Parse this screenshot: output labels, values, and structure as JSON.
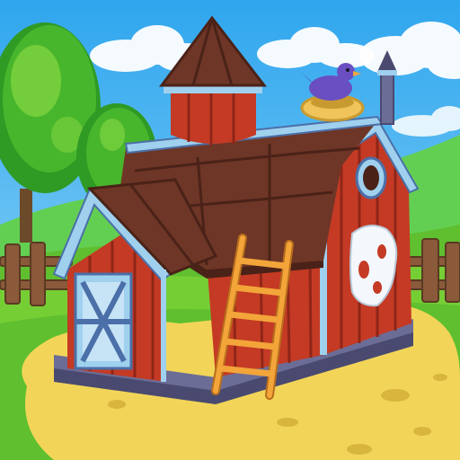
{
  "colors": {
    "sky_top": "#2fa6ee",
    "sky_bottom": "#9fdcf8",
    "cloud": "#ffffff",
    "hill_far": "#63cf52",
    "grass": "#5fbf2f",
    "grass_light": "#86d83a",
    "path": "#f2d558",
    "path_dark": "#d8b53d",
    "tree_dark": "#2f9a24",
    "tree_mid": "#48b62c",
    "tree_light": "#7fd440",
    "barn_red": "#c43a24",
    "barn_red_dark": "#8f2618",
    "barn_trim": "#9fd0ee",
    "barn_trim_dark": "#4b6fa8",
    "roof": "#6e3626",
    "roof_dark": "#4a2218",
    "stone": "#6c6d96",
    "stone_dark": "#4a4a70",
    "ladder": "#f3a53a",
    "ladder_dark": "#b86e1c",
    "bird": "#6a4fc2",
    "nest": "#f0c45a",
    "fence": "#8a5a3a"
  },
  "scene": {
    "title": "",
    "icons": [
      "barn-icon",
      "silo-icon",
      "ladder-icon",
      "bird-icon",
      "nest-icon",
      "tree-icon",
      "fence-icon",
      "cloud-icon",
      "door-icon",
      "horse-emblem-icon",
      "weathervane-icon"
    ]
  }
}
